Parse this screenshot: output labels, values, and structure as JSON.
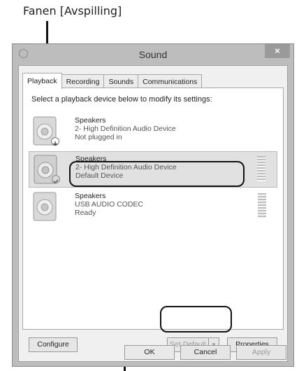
{
  "caption": "Fanen [Avspilling]",
  "window": {
    "title": "Sound",
    "close_glyph": "×",
    "tabs": [
      {
        "label": "Playback",
        "active": true
      },
      {
        "label": "Recording",
        "active": false
      },
      {
        "label": "Sounds",
        "active": false
      },
      {
        "label": "Communications",
        "active": false
      }
    ],
    "instruction": "Select a playback device below to modify its settings:",
    "devices": [
      {
        "name": "Speakers",
        "description": "2- High Definition Audio Device",
        "status": "Not plugged in",
        "badge": "down-arrow-icon",
        "selected": false
      },
      {
        "name": "Speakers",
        "description": "2- High Definition Audio Device",
        "status": "Default Device",
        "badge": "check-icon",
        "selected": true
      },
      {
        "name": "Speakers",
        "description": "USB AUDIO CODEC",
        "status": "Ready",
        "badge": "",
        "selected": false
      }
    ],
    "buttons": {
      "configure": "Configure",
      "set_default": "Set Default",
      "set_default_arrow": "▼",
      "properties": "Properties",
      "ok": "OK",
      "cancel": "Cancel",
      "apply": "Apply"
    }
  },
  "colors": {
    "window_frame": "#bdbdbd",
    "selection": "#e1e1e1",
    "callout": "#111111"
  }
}
